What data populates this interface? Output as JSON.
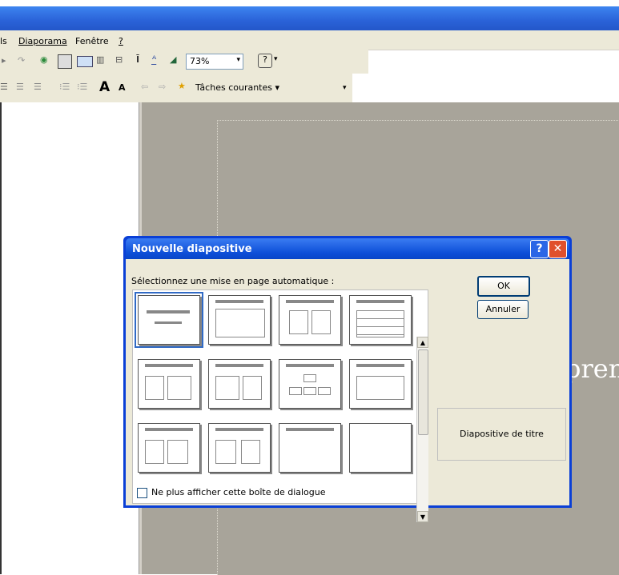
{
  "menu": {
    "items": [
      "ls",
      "Diaporama",
      "Fenêtre",
      "?"
    ]
  },
  "toolbar": {
    "zoom": "73%",
    "tasks_label": "Tâches courantes ▾"
  },
  "slide": {
    "partial_text": "pren"
  },
  "dialog": {
    "title": "Nouvelle diapositive",
    "help_glyph": "?",
    "close_glyph": "✕",
    "instruction": "Sélectionnez une mise en page automatique :",
    "ok_label": "OK",
    "cancel_label": "Annuler",
    "preview_label": "Diapositive de titre",
    "checkbox_label": "Ne plus afficher cette boîte de dialogue",
    "checkbox_checked": false,
    "layouts": [
      "title-slide",
      "bulleted-list",
      "two-column-text",
      "table",
      "text-and-chart",
      "chart-and-text",
      "org-chart",
      "chart",
      "text-and-clip-art",
      "clip-art-and-text",
      "title-only",
      "blank"
    ],
    "selected_layout": 0
  },
  "colors": {
    "titlebar": "#2a62d8",
    "dialog_border": "#0a3fd6",
    "selection": "#316ac5",
    "close_button": "#e0502c"
  }
}
